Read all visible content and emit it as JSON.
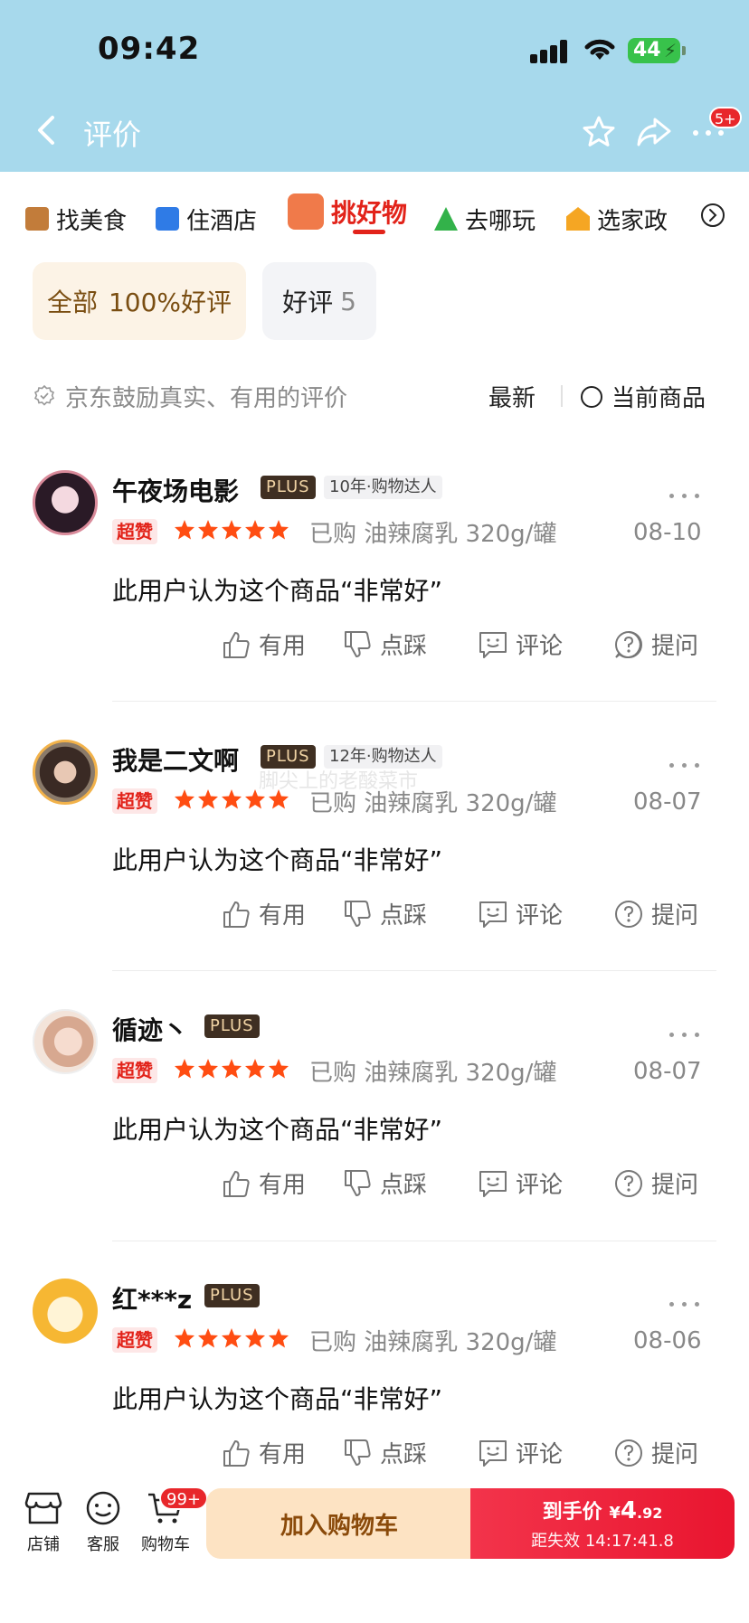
{
  "status_bar": {
    "time": "09:42",
    "battery": "44"
  },
  "nav": {
    "title": "评价",
    "more_badge": "5+"
  },
  "categories": [
    {
      "label": "找美食",
      "icon": "food-icon",
      "color": "#c27c3a"
    },
    {
      "label": "住酒店",
      "icon": "hotel-icon",
      "color": "#2f7be6"
    },
    {
      "label": "挑好物",
      "icon": "shopping-bag-icon",
      "color": "#e2231a",
      "active": true
    },
    {
      "label": "去哪玩",
      "icon": "mountain-icon",
      "color": "#33b24a"
    },
    {
      "label": "选家政",
      "icon": "home-service-icon",
      "color": "#f5a623"
    }
  ],
  "filters": {
    "all_label": "全部",
    "all_rate": "100%好评",
    "good_label": "好评",
    "good_count": "5"
  },
  "notice": "京东鼓励真实、有用的评价",
  "sort": {
    "latest": "最新",
    "current_goods": "当前商品"
  },
  "reviews": [
    {
      "name": "午夜场电影",
      "plus": "PLUS",
      "level": "10年·购物达人",
      "badge": "超赞",
      "rating": 5,
      "bought": "已购 油辣腐乳 320g/罐",
      "date": "08-10",
      "text": "此用户认为这个商品“非常好”"
    },
    {
      "name": "我是二文啊",
      "plus": "PLUS",
      "level": "12年·购物达人",
      "badge": "超赞",
      "rating": 5,
      "bought": "已购 油辣腐乳 320g/罐",
      "date": "08-07",
      "text": "此用户认为这个商品“非常好”"
    },
    {
      "name": "循迹丶",
      "plus": "PLUS",
      "level": "",
      "badge": "超赞",
      "rating": 5,
      "bought": "已购 油辣腐乳 320g/罐",
      "date": "08-07",
      "text": "此用户认为这个商品“非常好”"
    },
    {
      "name": "红***z",
      "plus": "PLUS",
      "level": "",
      "badge": "超赞",
      "rating": 5,
      "bought": "已购 油辣腐乳 320g/罐",
      "date": "08-06",
      "text": "此用户认为这个商品“非常好”"
    }
  ],
  "review_actions": {
    "useful": "有用",
    "dislike": "点踩",
    "comment": "评论",
    "ask": "提问"
  },
  "watermark": "脚尖上的老酸菜市",
  "bottom": {
    "store": "店铺",
    "service": "客服",
    "cart": "购物车",
    "cart_badge": "99+",
    "add_to_cart": "加入购物车",
    "price_label": "到手价",
    "price_symbol": "¥",
    "price_int": "4",
    "price_dec": ".92",
    "countdown": "距失效 14:17:41.8"
  },
  "colors": {
    "header_bg": "#a7d9ec",
    "accent_red": "#e2231a",
    "star": "#ff4d12"
  }
}
